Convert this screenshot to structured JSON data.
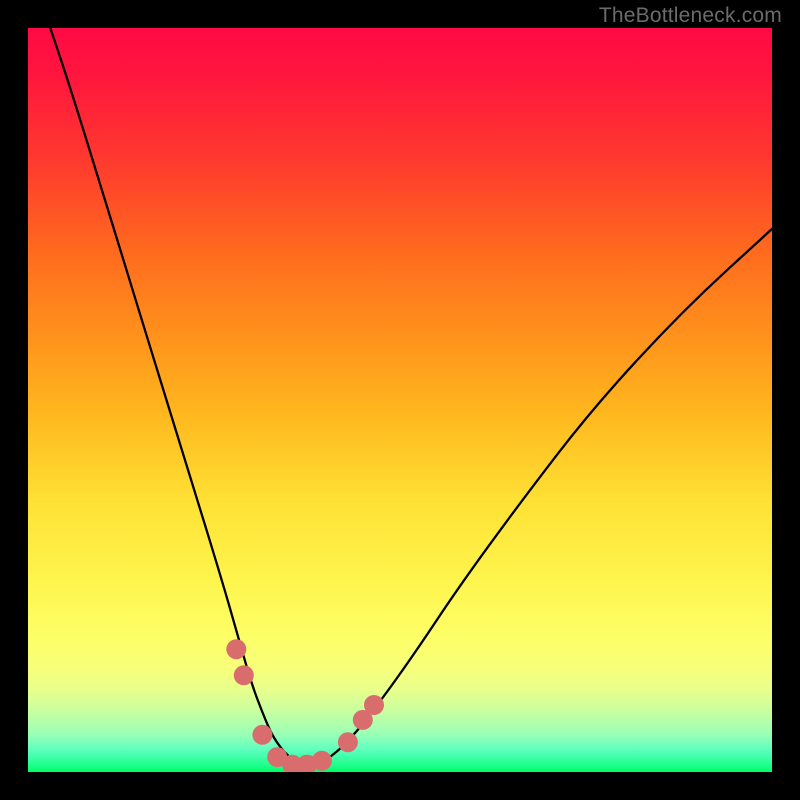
{
  "watermark": "TheBottleneck.com",
  "chart_data": {
    "type": "line",
    "title": "",
    "xlabel": "",
    "ylabel": "",
    "xlim": [
      0,
      100
    ],
    "ylim": [
      0,
      100
    ],
    "series": [
      {
        "name": "bottleneck-curve",
        "x": [
          3,
          6,
          10,
          14,
          18,
          22,
          26,
          28,
          30,
          31.5,
          33,
          35,
          37,
          38.5,
          40,
          43,
          47,
          52,
          58,
          66,
          76,
          88,
          100
        ],
        "y": [
          100,
          91,
          78,
          65,
          52,
          39,
          26,
          19,
          12,
          8,
          4.5,
          2,
          1,
          1,
          1.5,
          4,
          9,
          16,
          25,
          36,
          49,
          62,
          73
        ]
      }
    ],
    "markers": {
      "name": "highlighted-points",
      "color": "#d96d6d",
      "radius_px": 10,
      "points": [
        {
          "x": 28.0,
          "y": 16.5
        },
        {
          "x": 29.0,
          "y": 13.0
        },
        {
          "x": 31.5,
          "y": 5.0
        },
        {
          "x": 33.5,
          "y": 2.0
        },
        {
          "x": 35.5,
          "y": 1.0
        },
        {
          "x": 37.5,
          "y": 1.0
        },
        {
          "x": 39.5,
          "y": 1.5
        },
        {
          "x": 43.0,
          "y": 4.0
        },
        {
          "x": 45.0,
          "y": 7.0
        },
        {
          "x": 46.5,
          "y": 9.0
        }
      ]
    },
    "gradient_stops": [
      {
        "pos": 0,
        "color": "#ff0a44"
      },
      {
        "pos": 25,
        "color": "#ff6a1e"
      },
      {
        "pos": 50,
        "color": "#ffb81e"
      },
      {
        "pos": 75,
        "color": "#fef64f"
      },
      {
        "pos": 92,
        "color": "#c6ffa2"
      },
      {
        "pos": 100,
        "color": "#00ff66"
      }
    ]
  }
}
